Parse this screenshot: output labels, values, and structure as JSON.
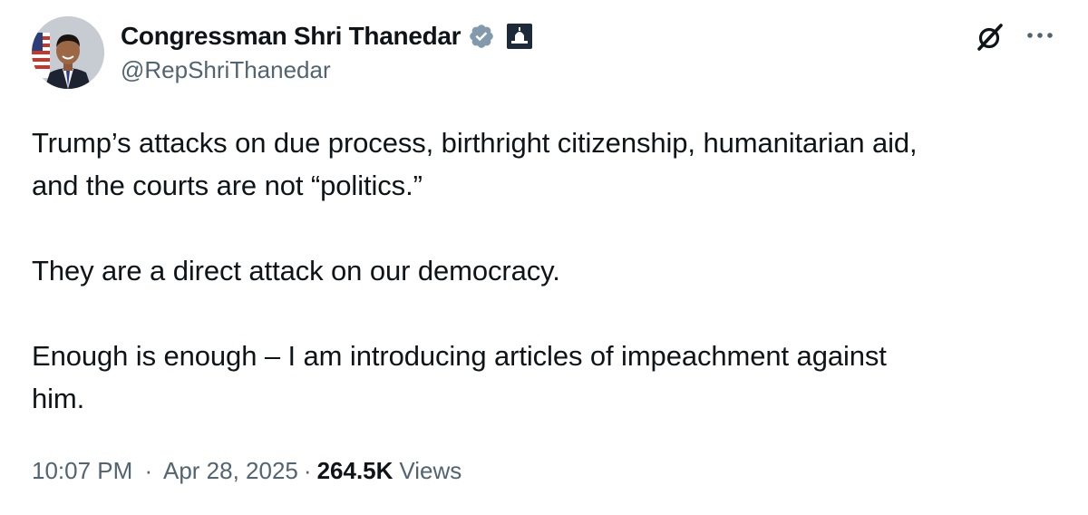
{
  "author": {
    "display_name": "Congressman Shri Thanedar",
    "handle": "@RepShriThanedar",
    "verified_badge": "verified-gray-badge-icon",
    "affiliation_badge": "capitol-building-icon"
  },
  "tweet": {
    "paragraphs": [
      "Trump’s attacks on due process, birthright citizenship, humanitarian aid, and the courts are not “politics.”",
      "They are a direct attack on our democracy.",
      "Enough is enough – I am introducing articles of impeachment against him."
    ],
    "line_breaks": {
      "p0_line1": "Trump’s attacks on due process, birthright citizenship, humanitarian aid,",
      "p0_line2": "and the courts are not “politics.”",
      "p2_line1": "Enough is enough – I am introducing articles of impeachment against",
      "p2_line2": "him."
    }
  },
  "meta": {
    "time": "10:07 PM",
    "date": "Apr 28, 2025",
    "separator": "·",
    "views_count": "264.5K",
    "views_label": "Views"
  },
  "icons": {
    "grok": "grok-icon",
    "more": "more-options-icon"
  },
  "colors": {
    "text_primary": "#0f1419",
    "text_secondary": "#536471",
    "badge_gray": "#829aab"
  }
}
